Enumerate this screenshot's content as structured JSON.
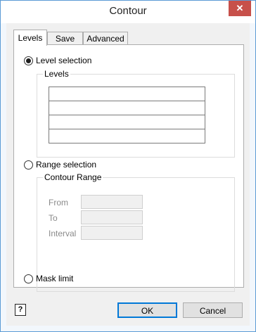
{
  "window": {
    "title": "Contour",
    "close_glyph": "✕"
  },
  "tabs": [
    "Levels",
    "Save",
    "Advanced"
  ],
  "levels_tab": {
    "level_selection_label": "Level selection",
    "level_selection_checked": true,
    "levels_group_label": "Levels",
    "levels_rows": [
      "",
      "",
      "",
      ""
    ],
    "range_selection_label": "Range selection",
    "contour_range_group_label": "Contour Range",
    "from_label": "From",
    "to_label": "To",
    "interval_label": "Interval",
    "from_value": "",
    "to_value": "",
    "interval_value": "",
    "mask_limit_label": "Mask limit"
  },
  "footer": {
    "help_glyph": "?",
    "ok_label": "OK",
    "cancel_label": "Cancel"
  },
  "colors": {
    "accent": "#0078d7",
    "close": "#c7504a",
    "frame": "#5b9bd5"
  }
}
